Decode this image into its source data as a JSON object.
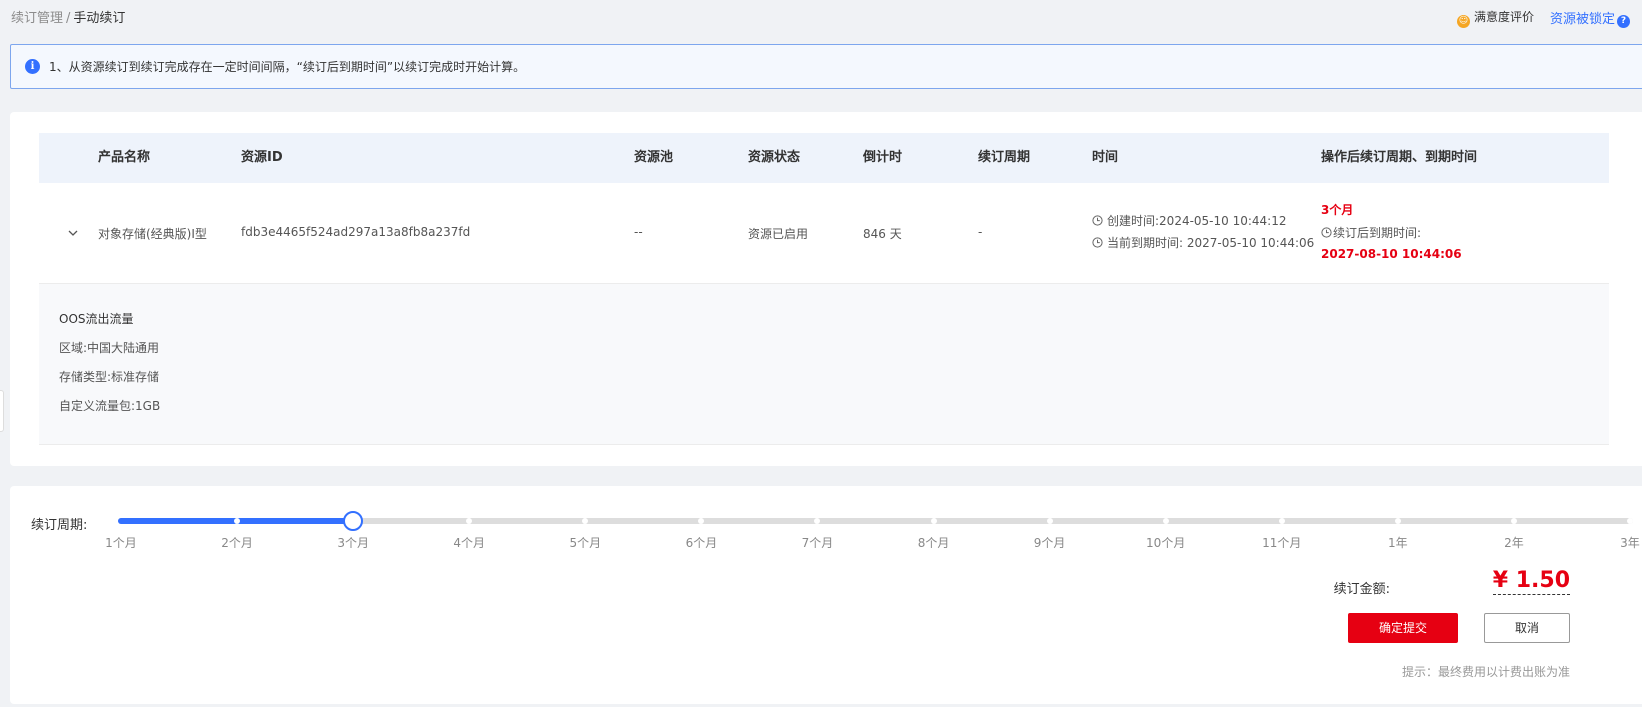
{
  "breadcrumb": {
    "parent": "续订管理",
    "separator": "/",
    "current": "手动续订"
  },
  "top_right": {
    "satisfaction": "满意度评价",
    "locked_link": "资源被锁定",
    "help_glyph": "?"
  },
  "notice": {
    "text": "1、从资源续订到续订完成存在一定时间间隔，“续订后到期时间”以续订完成时开始计算。"
  },
  "table": {
    "headers": [
      "产品名称",
      "资源ID",
      "资源池",
      "资源状态",
      "倒计时",
      "续订周期",
      "时间",
      "操作后续订周期、到期时间"
    ],
    "row": {
      "product": "对象存储(经典版)Ⅰ型",
      "resource_id": "fdb3e4465f524ad297a13a8fb8a237fd",
      "pool": "--",
      "status": "资源已启用",
      "countdown": "846 天",
      "period": "-",
      "created": "创建时间:2024-05-10 10:44:12",
      "expires": "当前到期时间: 2027-05-10 10:44:06",
      "after_period": "3个月",
      "after_label": "续订后到期时间:",
      "after_date": "2027-08-10 10:44:06"
    },
    "detail": {
      "title": "OOS流出流量",
      "region": "区域:中国大陆通用",
      "storage_type": "存储类型:标准存储",
      "package": "自定义流量包:1GB"
    }
  },
  "renewal": {
    "period_label": "续订周期:",
    "ticks": [
      "1个月",
      "2个月",
      "3个月",
      "4个月",
      "5个月",
      "6个月",
      "7个月",
      "8个月",
      "9个月",
      "10个月",
      "11个月",
      "1年",
      "2年",
      "3年"
    ],
    "selected_index": 2,
    "amount_label": "续订金额:",
    "amount": "¥ 1.50",
    "submit": "确定提交",
    "cancel": "取消",
    "tip": "提示：最终费用以计费出账为准"
  },
  "colors": {
    "accent": "#3370ff",
    "danger": "#e60012"
  }
}
